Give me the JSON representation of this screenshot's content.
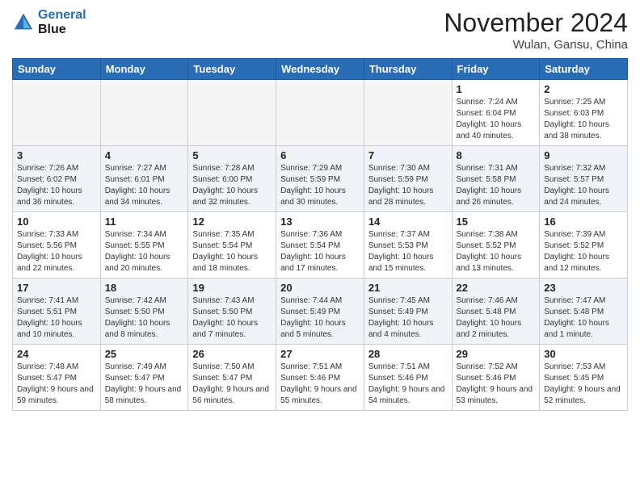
{
  "header": {
    "logo_line1": "General",
    "logo_line2": "Blue",
    "month": "November 2024",
    "location": "Wulan, Gansu, China"
  },
  "weekdays": [
    "Sunday",
    "Monday",
    "Tuesday",
    "Wednesday",
    "Thursday",
    "Friday",
    "Saturday"
  ],
  "weeks": [
    [
      {
        "day": "",
        "info": ""
      },
      {
        "day": "",
        "info": ""
      },
      {
        "day": "",
        "info": ""
      },
      {
        "day": "",
        "info": ""
      },
      {
        "day": "",
        "info": ""
      },
      {
        "day": "1",
        "info": "Sunrise: 7:24 AM\nSunset: 6:04 PM\nDaylight: 10 hours and 40 minutes."
      },
      {
        "day": "2",
        "info": "Sunrise: 7:25 AM\nSunset: 6:03 PM\nDaylight: 10 hours and 38 minutes."
      }
    ],
    [
      {
        "day": "3",
        "info": "Sunrise: 7:26 AM\nSunset: 6:02 PM\nDaylight: 10 hours and 36 minutes."
      },
      {
        "day": "4",
        "info": "Sunrise: 7:27 AM\nSunset: 6:01 PM\nDaylight: 10 hours and 34 minutes."
      },
      {
        "day": "5",
        "info": "Sunrise: 7:28 AM\nSunset: 6:00 PM\nDaylight: 10 hours and 32 minutes."
      },
      {
        "day": "6",
        "info": "Sunrise: 7:29 AM\nSunset: 5:59 PM\nDaylight: 10 hours and 30 minutes."
      },
      {
        "day": "7",
        "info": "Sunrise: 7:30 AM\nSunset: 5:59 PM\nDaylight: 10 hours and 28 minutes."
      },
      {
        "day": "8",
        "info": "Sunrise: 7:31 AM\nSunset: 5:58 PM\nDaylight: 10 hours and 26 minutes."
      },
      {
        "day": "9",
        "info": "Sunrise: 7:32 AM\nSunset: 5:57 PM\nDaylight: 10 hours and 24 minutes."
      }
    ],
    [
      {
        "day": "10",
        "info": "Sunrise: 7:33 AM\nSunset: 5:56 PM\nDaylight: 10 hours and 22 minutes."
      },
      {
        "day": "11",
        "info": "Sunrise: 7:34 AM\nSunset: 5:55 PM\nDaylight: 10 hours and 20 minutes."
      },
      {
        "day": "12",
        "info": "Sunrise: 7:35 AM\nSunset: 5:54 PM\nDaylight: 10 hours and 18 minutes."
      },
      {
        "day": "13",
        "info": "Sunrise: 7:36 AM\nSunset: 5:54 PM\nDaylight: 10 hours and 17 minutes."
      },
      {
        "day": "14",
        "info": "Sunrise: 7:37 AM\nSunset: 5:53 PM\nDaylight: 10 hours and 15 minutes."
      },
      {
        "day": "15",
        "info": "Sunrise: 7:38 AM\nSunset: 5:52 PM\nDaylight: 10 hours and 13 minutes."
      },
      {
        "day": "16",
        "info": "Sunrise: 7:39 AM\nSunset: 5:52 PM\nDaylight: 10 hours and 12 minutes."
      }
    ],
    [
      {
        "day": "17",
        "info": "Sunrise: 7:41 AM\nSunset: 5:51 PM\nDaylight: 10 hours and 10 minutes."
      },
      {
        "day": "18",
        "info": "Sunrise: 7:42 AM\nSunset: 5:50 PM\nDaylight: 10 hours and 8 minutes."
      },
      {
        "day": "19",
        "info": "Sunrise: 7:43 AM\nSunset: 5:50 PM\nDaylight: 10 hours and 7 minutes."
      },
      {
        "day": "20",
        "info": "Sunrise: 7:44 AM\nSunset: 5:49 PM\nDaylight: 10 hours and 5 minutes."
      },
      {
        "day": "21",
        "info": "Sunrise: 7:45 AM\nSunset: 5:49 PM\nDaylight: 10 hours and 4 minutes."
      },
      {
        "day": "22",
        "info": "Sunrise: 7:46 AM\nSunset: 5:48 PM\nDaylight: 10 hours and 2 minutes."
      },
      {
        "day": "23",
        "info": "Sunrise: 7:47 AM\nSunset: 5:48 PM\nDaylight: 10 hours and 1 minute."
      }
    ],
    [
      {
        "day": "24",
        "info": "Sunrise: 7:48 AM\nSunset: 5:47 PM\nDaylight: 9 hours and 59 minutes."
      },
      {
        "day": "25",
        "info": "Sunrise: 7:49 AM\nSunset: 5:47 PM\nDaylight: 9 hours and 58 minutes."
      },
      {
        "day": "26",
        "info": "Sunrise: 7:50 AM\nSunset: 5:47 PM\nDaylight: 9 hours and 56 minutes."
      },
      {
        "day": "27",
        "info": "Sunrise: 7:51 AM\nSunset: 5:46 PM\nDaylight: 9 hours and 55 minutes."
      },
      {
        "day": "28",
        "info": "Sunrise: 7:51 AM\nSunset: 5:46 PM\nDaylight: 9 hours and 54 minutes."
      },
      {
        "day": "29",
        "info": "Sunrise: 7:52 AM\nSunset: 5:46 PM\nDaylight: 9 hours and 53 minutes."
      },
      {
        "day": "30",
        "info": "Sunrise: 7:53 AM\nSunset: 5:45 PM\nDaylight: 9 hours and 52 minutes."
      }
    ]
  ]
}
